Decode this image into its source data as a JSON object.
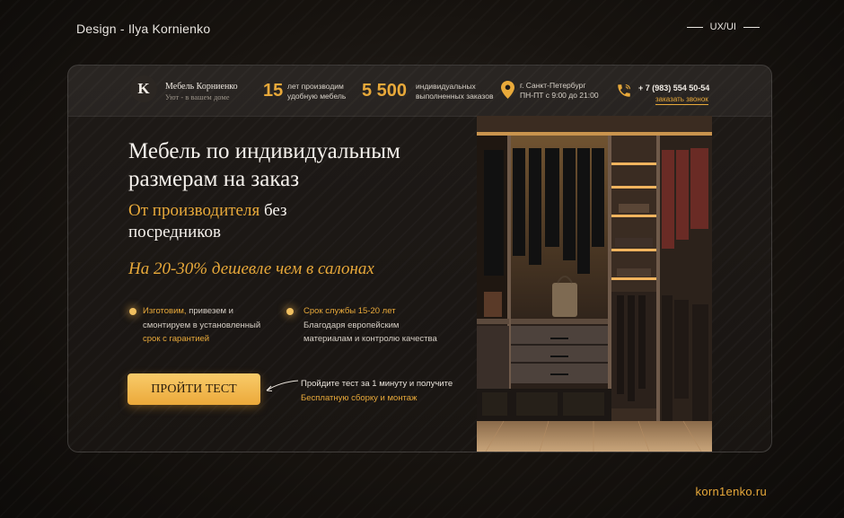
{
  "meta": {
    "designer": "Design - Ilya Kornienko",
    "tag": "UX/UI",
    "site": "korn1enko.ru"
  },
  "header": {
    "logo_letter": "K",
    "brand_name": "Мебель Корниенко",
    "brand_sub": "Уют - в вашем доме",
    "stat1": {
      "number": "15",
      "line1": "лет производим",
      "line2": "удобную мебель"
    },
    "stat2": {
      "number": "5 500",
      "line1": "индивидуальных",
      "line2": "выполненных заказов"
    },
    "address": {
      "line1": "г. Санкт-Петербург",
      "line2": "ПН-ПТ с 9:00 до 21:00"
    },
    "phone": "+ 7 (983) 554 50-54",
    "callback": "заказать звонок"
  },
  "hero": {
    "title_line1": "Мебель по индивидуальным",
    "title_line2": "размерам на заказ",
    "sub_highlight": "От производителя",
    "sub_rest": "без",
    "sub_line2": "посредников",
    "promo": "На 20-30% дешевле чем в салонах"
  },
  "features": [
    {
      "line1_hl": "Изготовим,",
      "line1_rest": "привезем и",
      "line2": "смонтируем в установленный",
      "line3_hl": "срок с гарантией"
    },
    {
      "line1_hl": "Срок службы 15-20 лет",
      "line2": "Благодаря европейским",
      "line3": "материалам и контролю качества"
    }
  ],
  "cta": {
    "button_label": "ПРОЙТИ ТЕСТ",
    "note_line1": "Пройдите тест за 1 минуту и получите",
    "note_line2": "Бесплатную сборку и монтаж"
  },
  "colors": {
    "accent": "#e8a93a",
    "background": "#17130f",
    "text": "#f5f1ec"
  },
  "icons": {
    "address": "location-pin-icon",
    "phone": "phone-icon"
  }
}
